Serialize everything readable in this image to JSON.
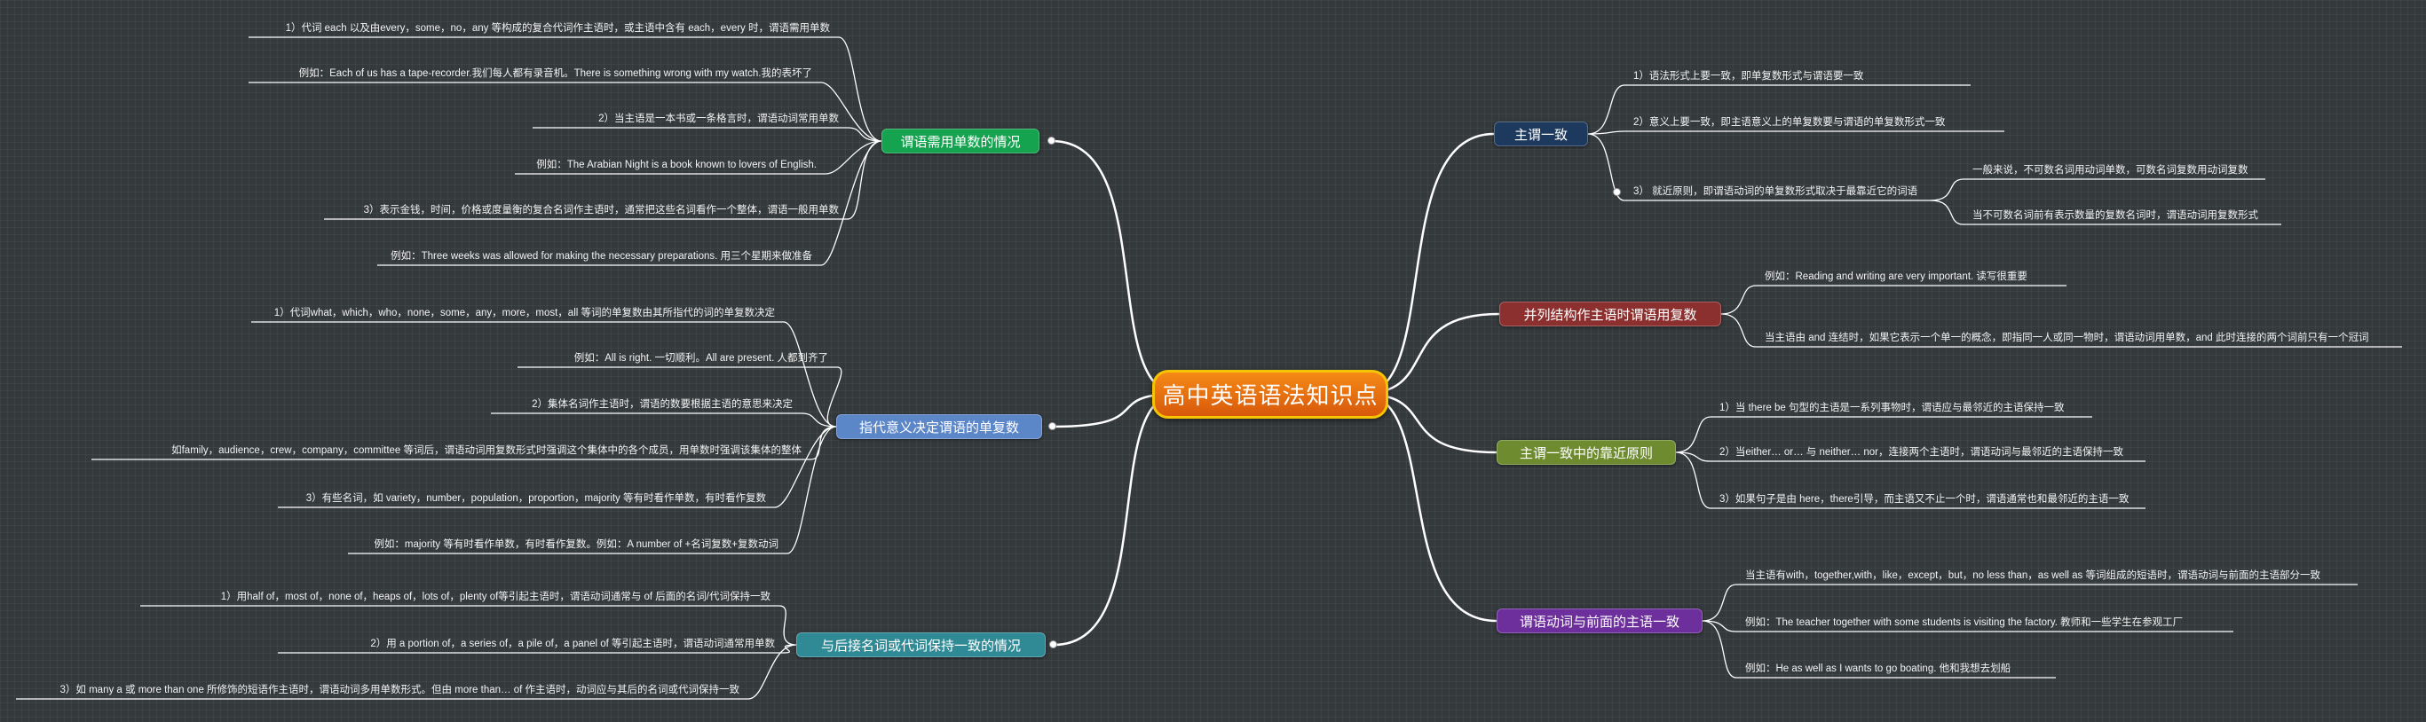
{
  "root": {
    "title": "高中英语语法知识点"
  },
  "branches": {
    "b1": {
      "label": "主谓一致",
      "color": "#1d3a5e"
    },
    "b2": {
      "label": "并列结构作主语时谓语用复数",
      "color": "#8b2f2f"
    },
    "b3": {
      "label": "主谓一致中的靠近原则",
      "color": "#6e8c2f"
    },
    "b4": {
      "label": "谓语动词与前面的主语一致",
      "color": "#6d2f9c"
    },
    "b5": {
      "label": "谓语需用单数的情况",
      "color": "#15a350"
    },
    "b6": {
      "label": "指代意义决定谓语的单复数",
      "color": "#5b86c8"
    },
    "b7": {
      "label": "与后接名词或代词保持一致的情况",
      "color": "#2f8a96"
    }
  },
  "leaves": {
    "b1": [
      "1）语法形式上要一致，即单复数形式与谓语要一致",
      "2）意义上要一致，即主语意义上的单复数要与谓语的单复数形式一致",
      "3）  就近原则，即谓语动词的单复数形式取决于最靠近它的词语"
    ],
    "b1_sub": [
      "一般来说，不可数名词用动词单数，可数名词复数用动词复数",
      "当不可数名词前有表示数量的复数名词时，谓语动词用复数形式"
    ],
    "b2": [
      "例如：Reading and writing are very important. 读写很重要",
      "当主语由 and 连结时，如果它表示一个单一的概念，即指同一人或同一物时，谓语动词用单数，and 此时连接的两个词前只有一个冠词"
    ],
    "b3": [
      "1）当 there be 句型的主语是一系列事物时，谓语应与最邻近的主语保持一致",
      "2）当either… or… 与 neither… nor，连接两个主语时，谓语动词与最邻近的主语保持一致",
      "3）如果句子是由 here，there引导，而主语又不止一个时，谓语通常也和最邻近的主语一致"
    ],
    "b4": [
      "当主语有with，together,with，like，except，but，no less than，as well as 等词组成的短语时，谓语动词与前面的主语部分一致",
      "例如：The teacher together with some students is visiting the factory. 教师和一些学生在参观工厂",
      "例如：He as well as I wants to go boating. 他和我想去划船"
    ],
    "b5": [
      "1）代词 each 以及由every，some，no，any 等构成的复合代词作主语时，或主语中含有 each，every 时，谓语需用单数",
      "例如：Each of us has a tape-recorder.我们每人都有录音机。There is something wrong with my watch.我的表坏了",
      "2）当主语是一本书或一条格言时，谓语动词常用单数",
      "例如：The Arabian Night is a book known to lovers of English.",
      "3）表示金钱，时间，价格或度量衡的复合名词作主语时，通常把这些名词看作一个整体，谓语一般用单数",
      "例如：Three weeks was allowed for making the necessary preparations. 用三个星期来做准备"
    ],
    "b6": [
      "1）代词what，which，who，none，some，any，more，most，all 等词的单复数由其所指代的词的单复数决定",
      "例如：All is right. 一切顺利。All are present. 人都到齐了",
      "2）集体名词作主语时，谓语的数要根据主语的意思来决定",
      "如family，audience，crew，company，committee 等词后，谓语动词用复数形式时强调这个集体中的各个成员，用单数时强调该集体的整体",
      "3）有些名词，如 variety，number，population，proportion，majority 等有时看作单数，有时看作复数",
      "例如：majority 等有时看作单数，有时看作复数。例如：A number of +名词复数+复数动词"
    ],
    "b7": [
      "1）用half of，most of，none of，heaps of，lots of，plenty of等引起主语时，谓语动词通常与 of 后面的名词/代词保持一致",
      "2）用 a portion of，a series of，a pile of，a panel of 等引起主语时，谓语动词通常用单数",
      "3）如 many a 或 more than one 所修饰的短语作主语时，谓语动词多用单数形式。但由 more than… of 作主语时，动词应与其后的名词或代词保持一致"
    ]
  }
}
